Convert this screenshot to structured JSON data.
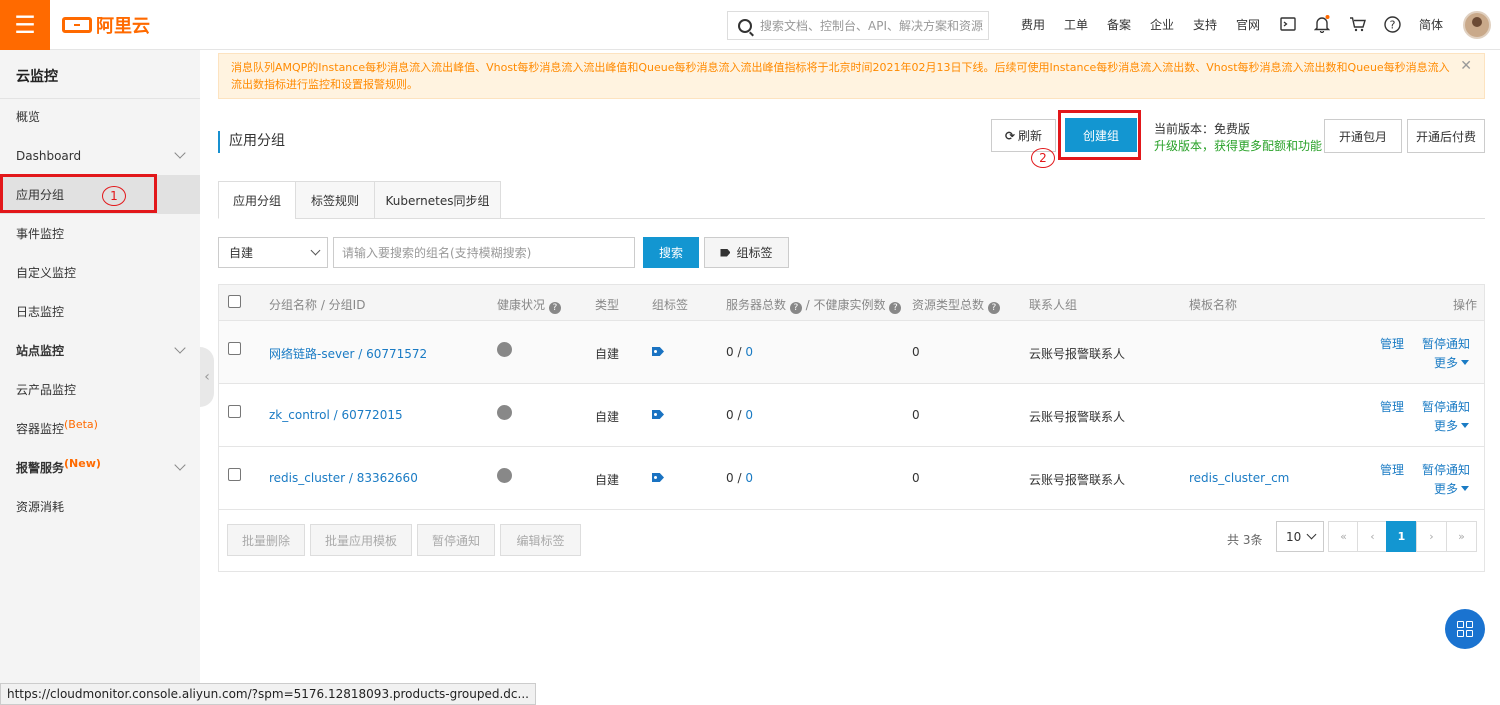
{
  "topbar": {
    "brand": "阿里云",
    "search_placeholder": "搜索文档、控制台、API、解决方案和资源",
    "nav": [
      "费用",
      "工单",
      "备案",
      "企业",
      "支持",
      "官网"
    ],
    "lang": "简体",
    "icons": [
      "terminal-icon",
      "bell-icon",
      "cart-icon",
      "help-icon"
    ]
  },
  "sidebar": {
    "title": "云监控",
    "items": [
      {
        "label": "概览"
      },
      {
        "label": "Dashboard",
        "expand": true
      },
      {
        "label": "应用分组",
        "active": true
      },
      {
        "label": "事件监控"
      },
      {
        "label": "自定义监控"
      },
      {
        "label": "日志监控"
      },
      {
        "label": "站点监控",
        "expand": true
      },
      {
        "label": "云产品监控"
      },
      {
        "label": "容器监控",
        "sup": "(Beta)"
      },
      {
        "label": "报警服务",
        "sup": "(New)",
        "expand": true
      },
      {
        "label": "资源消耗"
      }
    ]
  },
  "annotations": {
    "one": "1",
    "two": "2"
  },
  "notice": "消息队列AMQP的Instance每秒消息流入流出峰值、Vhost每秒消息流入流出峰值和Queue每秒消息流入流出峰值指标将于北京时间2021年02月13日下线。后续可使用Instance每秒消息流入流出数、Vhost每秒消息流入流出数和Queue每秒消息流入流出数指标进行监控和设置报警规则。",
  "page": {
    "title": "应用分组",
    "refresh": "刷新",
    "create": "创建组",
    "version": "当前版本：免费版",
    "upgrade": "升级版本，获得更多配额和功能",
    "monthly": "开通包月",
    "postpaid": "开通后付费"
  },
  "tabs": [
    "应用分组",
    "标签规则",
    "Kubernetes同步组"
  ],
  "filter": {
    "select": "自建",
    "placeholder": "请输入要搜索的组名(支持模糊搜索)",
    "search": "搜索",
    "tag_btn": "组标签"
  },
  "table": {
    "headers": {
      "name": "分组名称 / 分组ID",
      "health": "健康状况",
      "type": "类型",
      "tag": "组标签",
      "servers": "服务器总数",
      "unhealthy": "/ 不健康实例数",
      "restype": "资源类型总数",
      "contact": "联系人组",
      "template": "模板名称",
      "ops": "操作"
    },
    "rows": [
      {
        "name": "网络链路-sever",
        "id": "60771572",
        "type": "自建",
        "servers": "0",
        "unhealthy": "0",
        "restype": "0",
        "contact": "云账号报警联系人",
        "template": "",
        "manage": "管理",
        "pause": "暂停通知",
        "more": "更多"
      },
      {
        "name": "zk_control",
        "id": "60772015",
        "type": "自建",
        "servers": "0",
        "unhealthy": "0",
        "restype": "0",
        "contact": "云账号报警联系人",
        "template": "",
        "manage": "管理",
        "pause": "暂停通知",
        "more": "更多"
      },
      {
        "name": "redis_cluster",
        "id": "83362660",
        "type": "自建",
        "servers": "0",
        "unhealthy": "0",
        "restype": "0",
        "contact": "云账号报警联系人",
        "template": "redis_cluster_cm",
        "manage": "管理",
        "pause": "暂停通知",
        "more": "更多"
      }
    ]
  },
  "bulk": [
    "批量删除",
    "批量应用模板",
    "暂停通知",
    "编辑标签"
  ],
  "pager": {
    "total": "共 3条",
    "size": "10",
    "first": "«",
    "prev": "‹",
    "page": "1",
    "next": "›",
    "last": "»"
  },
  "statusbar": "https://cloudmonitor.console.aliyun.com/?spm=5176.12818093.products-grouped.dc...",
  "colors": {
    "brand": "#ff6a00",
    "primary": "#1396d1",
    "annotation": "#e2171a",
    "link": "#1a7bc4"
  }
}
